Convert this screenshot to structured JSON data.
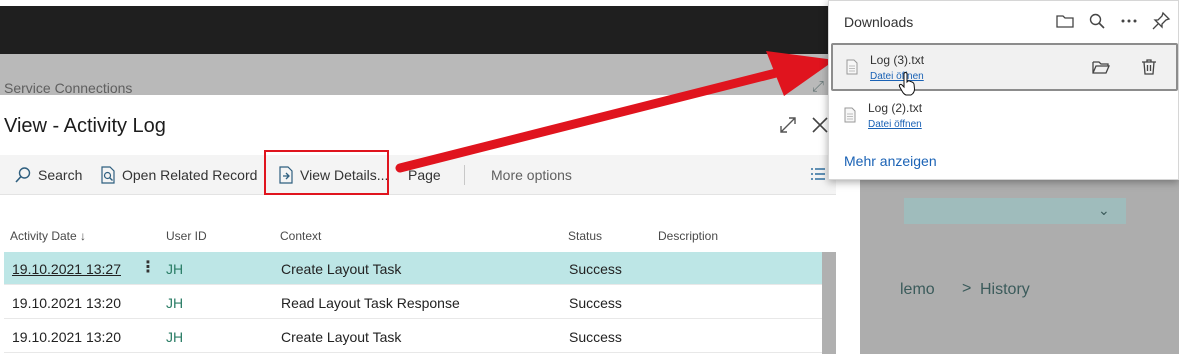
{
  "background": {
    "page_title": "Service Connections",
    "breadcrumb_partial": "lemo",
    "breadcrumb_separator": ">",
    "breadcrumb_history": "History"
  },
  "dialog": {
    "title": "View - Activity Log",
    "toolbar": {
      "search": "Search",
      "open_related": "Open Related Record",
      "view_details": "View Details...",
      "page": "Page",
      "more_options": "More options"
    },
    "columns": [
      "Activity Date ↓",
      "User ID",
      "Context",
      "Status",
      "Description"
    ],
    "rows": [
      {
        "date": "19.10.2021 13:27",
        "user": "JH",
        "context": "Create Layout Task",
        "status": "Success",
        "selected": true
      },
      {
        "date": "19.10.2021 13:20",
        "user": "JH",
        "context": "Read Layout Task Response",
        "status": "Success",
        "selected": false
      },
      {
        "date": "19.10.2021 13:20",
        "user": "JH",
        "context": "Create Layout Task",
        "status": "Success",
        "selected": false
      }
    ],
    "row_menu": "⋮"
  },
  "downloads": {
    "title": "Downloads",
    "items": [
      {
        "name": "Log (3).txt",
        "action": "Datei öffnen"
      },
      {
        "name": "Log (2).txt",
        "action": "Datei öffnen"
      }
    ],
    "show_more": "Mehr anzeigen"
  },
  "colors": {
    "selected_row": "#bde6e6",
    "highlight_red": "#e0141e",
    "link_blue": "#1a62b5",
    "user_id_green": "#2a7d66"
  }
}
